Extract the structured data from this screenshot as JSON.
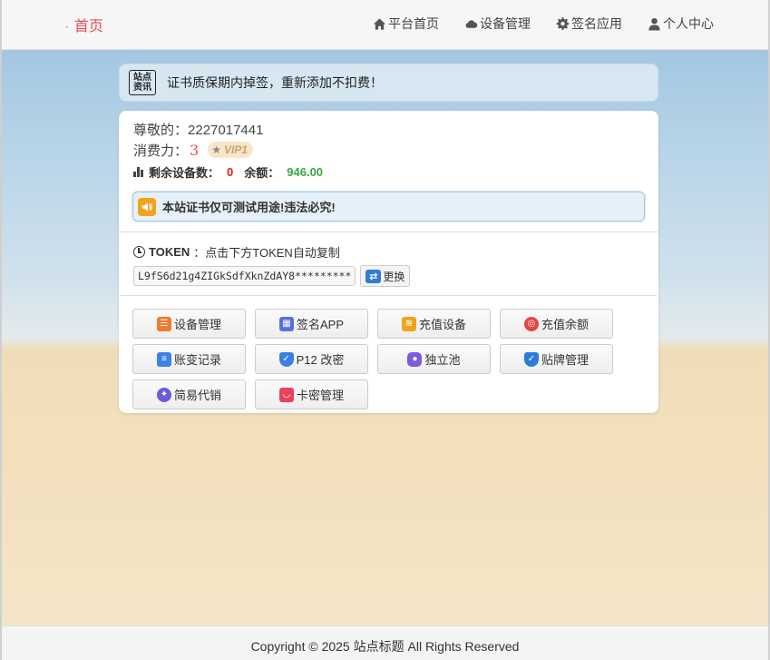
{
  "header": {
    "brand": "首页",
    "nav": [
      {
        "label": "平台首页",
        "icon": "home-icon"
      },
      {
        "label": "设备管理",
        "icon": "cloud-icon"
      },
      {
        "label": "签名应用",
        "icon": "gear-icon"
      },
      {
        "label": "个人中心",
        "icon": "user-icon"
      }
    ]
  },
  "notice": {
    "badge_line1": "站点",
    "badge_line2": "资讯",
    "text": "证书质保期内掉签，重新添加不扣费！"
  },
  "account": {
    "greeting_label": "尊敬的：",
    "user_id": "2227017441",
    "power_label": "消费力：",
    "power_value": "3",
    "vip_label": "VIP1",
    "devices_label": "剩余设备数：",
    "devices_value": "0",
    "balance_label": "余额：",
    "balance_value": "946.00"
  },
  "alert": {
    "text": "本站证书仅可测试用途!违法必究!"
  },
  "token": {
    "label": "TOKEN",
    "hint": "：点击下方TOKEN自动复制",
    "value": "L9fS6d21g4ZIGkSdfXknZdAY8*********",
    "swap_label": "更换"
  },
  "actions": [
    {
      "label": "设备管理",
      "icon": "list-icon",
      "color": "#f07b2e"
    },
    {
      "label": "签名APP",
      "icon": "grid-icon",
      "color": "#5a6ee0"
    },
    {
      "label": "充值设备",
      "icon": "coins-icon",
      "color": "#f2a31b"
    },
    {
      "label": "充值余额",
      "icon": "target-icon",
      "color": "#e84343"
    },
    {
      "label": "账变记录",
      "icon": "doc-icon",
      "color": "#3b82e8"
    },
    {
      "label": "P12 改密",
      "icon": "shield-icon",
      "color": "#3b7fe0"
    },
    {
      "label": "独立池",
      "icon": "lock-icon",
      "color": "#7b5be0"
    },
    {
      "label": "贴牌管理",
      "icon": "shield-check-icon",
      "color": "#2f7bd8"
    },
    {
      "label": "简易代销",
      "icon": "share-icon",
      "color": "#6a5ae0"
    },
    {
      "label": "卡密管理",
      "icon": "bag-icon",
      "color": "#e84359"
    }
  ],
  "footer": {
    "text": "Copyright © 2025 站点标题 All Rights Reserved"
  }
}
